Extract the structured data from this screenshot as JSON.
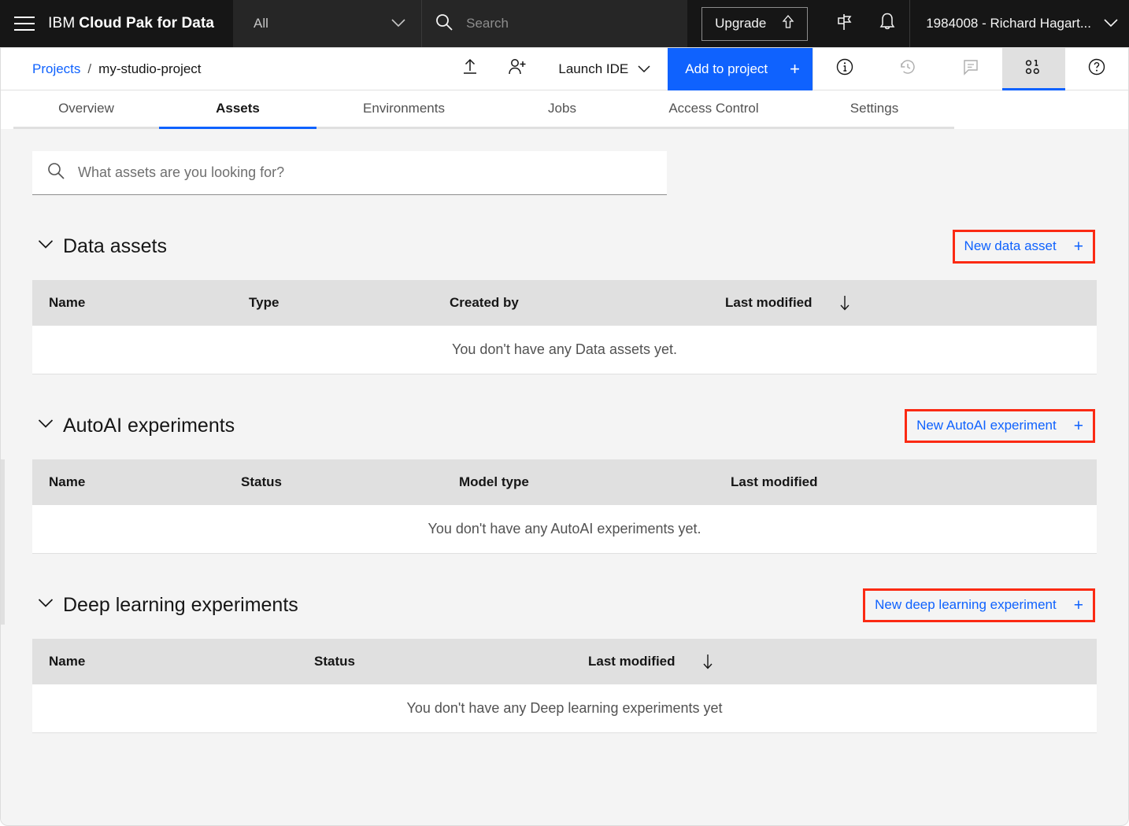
{
  "global_header": {
    "menu_icon": "hamburger-menu-icon",
    "brand_light": "IBM",
    "brand_bold": "Cloud Pak for Data",
    "scope_value": "All",
    "scope_chevron": "chevron-down-icon",
    "search_placeholder": "Search",
    "search_icon": "search-icon",
    "upgrade_label": "Upgrade",
    "upgrade_icon": "upgrade-arrow-icon",
    "signpost_icon": "signpost-icon",
    "notification_icon": "bell-icon",
    "user_label": "1984008 - Richard Hagart...",
    "user_chevron": "chevron-down-icon",
    "background": "#161616",
    "field_background": "#262626"
  },
  "action_bar": {
    "breadcrumb_root": "Projects",
    "breadcrumb_separator": "/",
    "breadcrumb_current": "my-studio-project",
    "upload_icon": "upload-icon",
    "add_collaborator_icon": "add-user-icon",
    "launch_ide_label": "Launch IDE",
    "launch_ide_chevron": "chevron-down-icon",
    "add_to_project_label": "Add to project",
    "add_to_project_plus": "+",
    "add_to_project_color": "#0f62fe",
    "utility_icons": [
      {
        "name": "info-icon",
        "state": "default"
      },
      {
        "name": "history-clock-icon",
        "state": "disabled"
      },
      {
        "name": "comment-icon",
        "state": "disabled"
      },
      {
        "name": "data-binary-icon",
        "state": "active"
      },
      {
        "name": "help-icon",
        "state": "default"
      }
    ]
  },
  "tabs": [
    {
      "label": "Overview",
      "selected": false
    },
    {
      "label": "Assets",
      "selected": true
    },
    {
      "label": "Environments",
      "selected": false
    },
    {
      "label": "Jobs",
      "selected": false
    },
    {
      "label": "Access Control",
      "selected": false
    },
    {
      "label": "Settings",
      "selected": false
    }
  ],
  "assets_search": {
    "icon": "search-icon",
    "placeholder": "What assets are you looking for?",
    "value": ""
  },
  "sections": [
    {
      "id": "data-assets",
      "toggle_icon": "chevron-down-icon",
      "title": "Data assets",
      "action_label": "New data asset",
      "action_plus": "+",
      "action_highlighted": true,
      "highlight_color": "#fb2a13",
      "columns": [
        {
          "label": "Name",
          "sort": false
        },
        {
          "label": "Type",
          "sort": false
        },
        {
          "label": "Created by",
          "sort": false
        },
        {
          "label": "Last modified",
          "sort": true,
          "sort_icon": "arrow-down-icon"
        }
      ],
      "empty_message": "You don't have any Data assets yet."
    },
    {
      "id": "autoai-experiments",
      "toggle_icon": "chevron-down-icon",
      "title": "AutoAI experiments",
      "action_label": "New AutoAI experiment",
      "action_plus": "+",
      "action_highlighted": true,
      "highlight_color": "#fb2a13",
      "columns": [
        {
          "label": "Name",
          "sort": false
        },
        {
          "label": "Status",
          "sort": false
        },
        {
          "label": "Model type",
          "sort": false
        },
        {
          "label": "Last modified",
          "sort": false
        }
      ],
      "empty_message": "You don't have any AutoAI experiments yet."
    },
    {
      "id": "deep-learning-experiments",
      "toggle_icon": "chevron-down-icon",
      "title": "Deep learning experiments",
      "action_label": "New deep learning experiment",
      "action_plus": "+",
      "action_highlighted": true,
      "highlight_color": "#fb2a13",
      "columns": [
        {
          "label": "Name",
          "sort": false
        },
        {
          "label": "Status",
          "sort": false
        },
        {
          "label": "Last modified",
          "sort": true,
          "sort_icon": "arrow-down-icon"
        }
      ],
      "empty_message": "You don't have any Deep learning experiments yet"
    }
  ]
}
